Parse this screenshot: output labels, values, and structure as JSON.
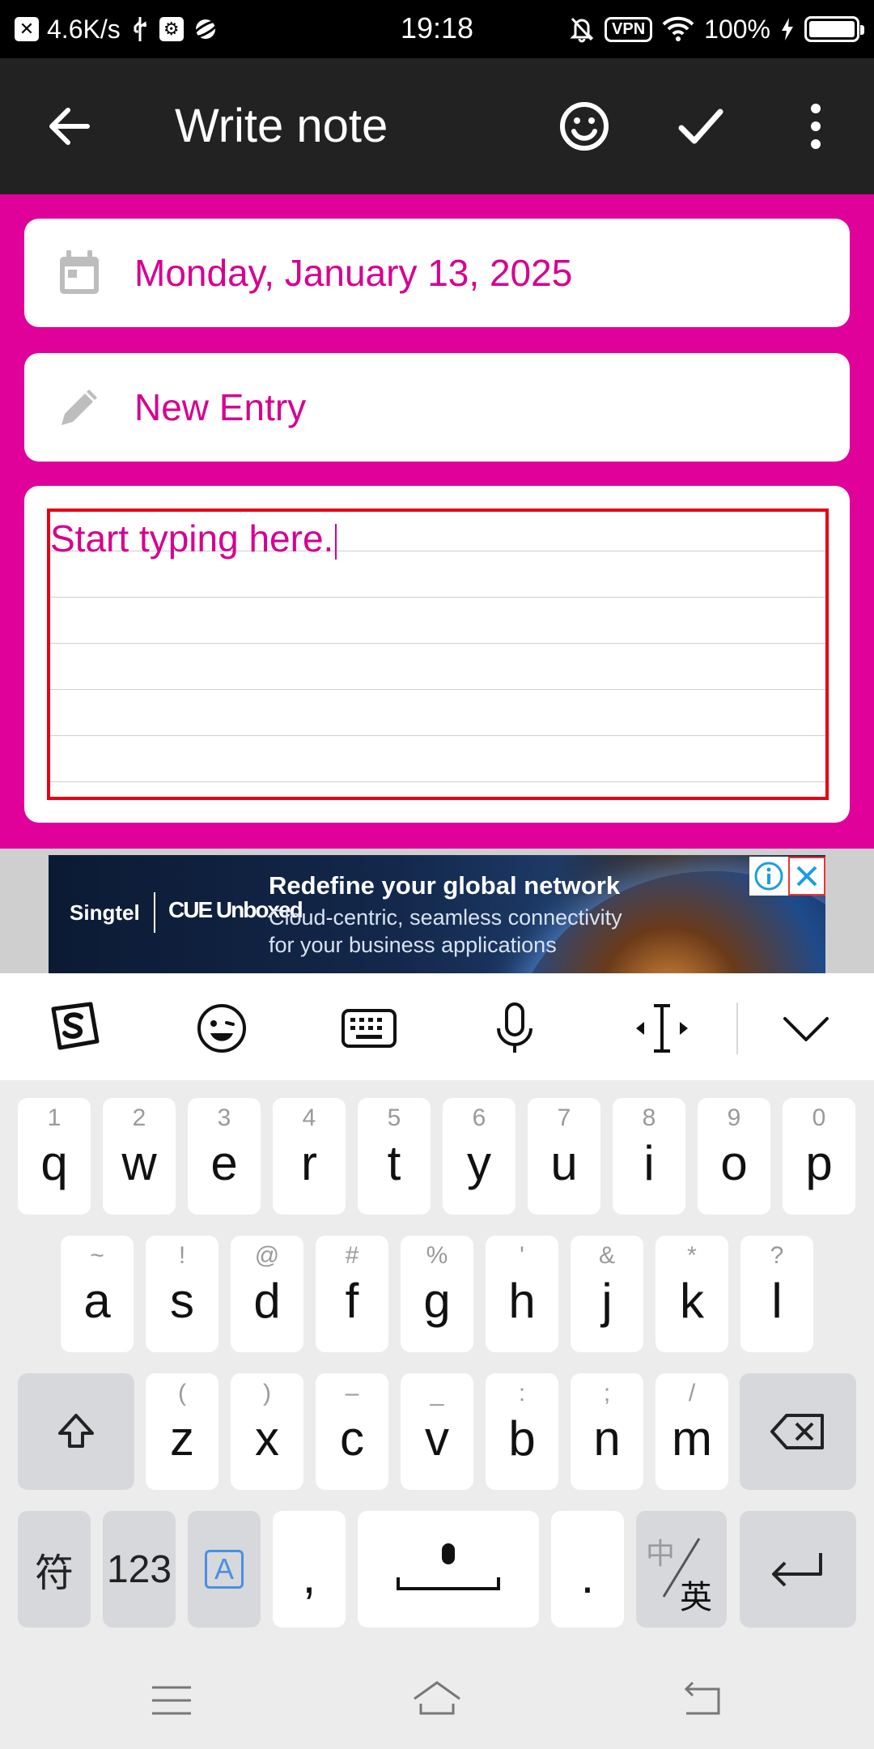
{
  "status_bar": {
    "net_speed": "4.6K/s",
    "time": "19:18",
    "vpn": "VPN",
    "battery": "100%"
  },
  "toolbar": {
    "title": "Write note",
    "icons": [
      "back-arrow-icon",
      "emoji-icon",
      "check-icon",
      "more-icon"
    ]
  },
  "note": {
    "date": "Monday, January 13, 2025",
    "title": "New Entry",
    "body_placeholder": "Start typing here."
  },
  "ad": {
    "logo_left": "Singtel",
    "logo_right": "CUE Unboxed",
    "headline": "Redefine your global network",
    "line1": "Cloud-centric, seamless connectivity",
    "line2": "for your business applications"
  },
  "keyboard": {
    "toolbar_icons": [
      "sogou-logo-icon",
      "emoji-icon",
      "keyboard-icon",
      "mic-icon",
      "cursor-icon",
      "collapse-icon"
    ],
    "row1": [
      {
        "sec": "1",
        "pri": "q"
      },
      {
        "sec": "2",
        "pri": "w"
      },
      {
        "sec": "3",
        "pri": "e"
      },
      {
        "sec": "4",
        "pri": "r"
      },
      {
        "sec": "5",
        "pri": "t"
      },
      {
        "sec": "6",
        "pri": "y"
      },
      {
        "sec": "7",
        "pri": "u"
      },
      {
        "sec": "8",
        "pri": "i"
      },
      {
        "sec": "9",
        "pri": "o"
      },
      {
        "sec": "0",
        "pri": "p"
      }
    ],
    "row2": [
      {
        "sec": "~",
        "pri": "a"
      },
      {
        "sec": "!",
        "pri": "s"
      },
      {
        "sec": "@",
        "pri": "d"
      },
      {
        "sec": "#",
        "pri": "f"
      },
      {
        "sec": "%",
        "pri": "g"
      },
      {
        "sec": "'",
        "pri": "h"
      },
      {
        "sec": "&",
        "pri": "j"
      },
      {
        "sec": "*",
        "pri": "k"
      },
      {
        "sec": "?",
        "pri": "l"
      }
    ],
    "row3": [
      {
        "sec": "(",
        "pri": "z"
      },
      {
        "sec": ")",
        "pri": "x"
      },
      {
        "sec": "–",
        "pri": "c"
      },
      {
        "sec": "_",
        "pri": "v"
      },
      {
        "sec": ":",
        "pri": "b"
      },
      {
        "sec": ";",
        "pri": "n"
      },
      {
        "sec": "/",
        "pri": "m"
      }
    ],
    "sym_key": "符",
    "num_key": "123",
    "mode_key": "A",
    "comma_key": ",",
    "period_key": ".",
    "lang_top": "中",
    "lang_bottom": "英"
  },
  "nav_icons": [
    "menu-icon",
    "home-icon",
    "back-icon"
  ]
}
